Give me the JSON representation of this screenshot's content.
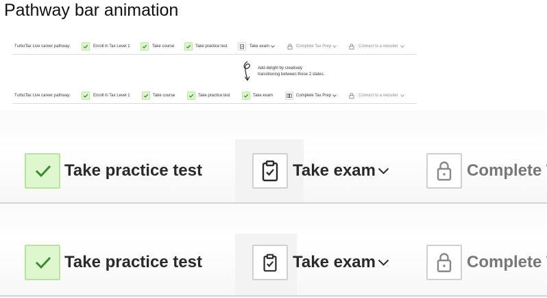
{
  "title": "Pathway bar animation",
  "pathway_small_top": {
    "label": "TurboTax Live career pathway:",
    "steps": [
      {
        "label": "Enroll in Tax Level 1",
        "state": "done"
      },
      {
        "label": "Take course",
        "state": "done"
      },
      {
        "label": "Take practice test",
        "state": "done"
      },
      {
        "label": "Take exam",
        "state": "current"
      },
      {
        "label": "Complete Tax Prep",
        "state": "locked"
      },
      {
        "label": "Connect to a recruiter",
        "state": "locked"
      }
    ]
  },
  "annotation": {
    "line1": "Add delight by creatively",
    "line2": "transitioning between these 2 states."
  },
  "pathway_small_bottom": {
    "label": "TurboTax Live career pathway:",
    "steps": [
      {
        "label": "Enroll in Tax Level 1",
        "state": "done"
      },
      {
        "label": "Take course",
        "state": "done"
      },
      {
        "label": "Take practice test",
        "state": "done"
      },
      {
        "label": "Take exam",
        "state": "done"
      },
      {
        "label": "Complete Tax Prep",
        "state": "current"
      },
      {
        "label": "Connect to a recruiter",
        "state": "locked"
      }
    ]
  },
  "zoom_top": {
    "practice": "Take practice test",
    "exam": "Take exam",
    "complete": "Complete T"
  },
  "zoom_bottom": {
    "practice": "Take practice test",
    "exam": "Take exam",
    "complete": "Complete T"
  },
  "colors": {
    "done_fill": "#dff7cf",
    "done_border": "#b6e49b",
    "check": "#3c8a2e",
    "muted_text": "#777777"
  }
}
